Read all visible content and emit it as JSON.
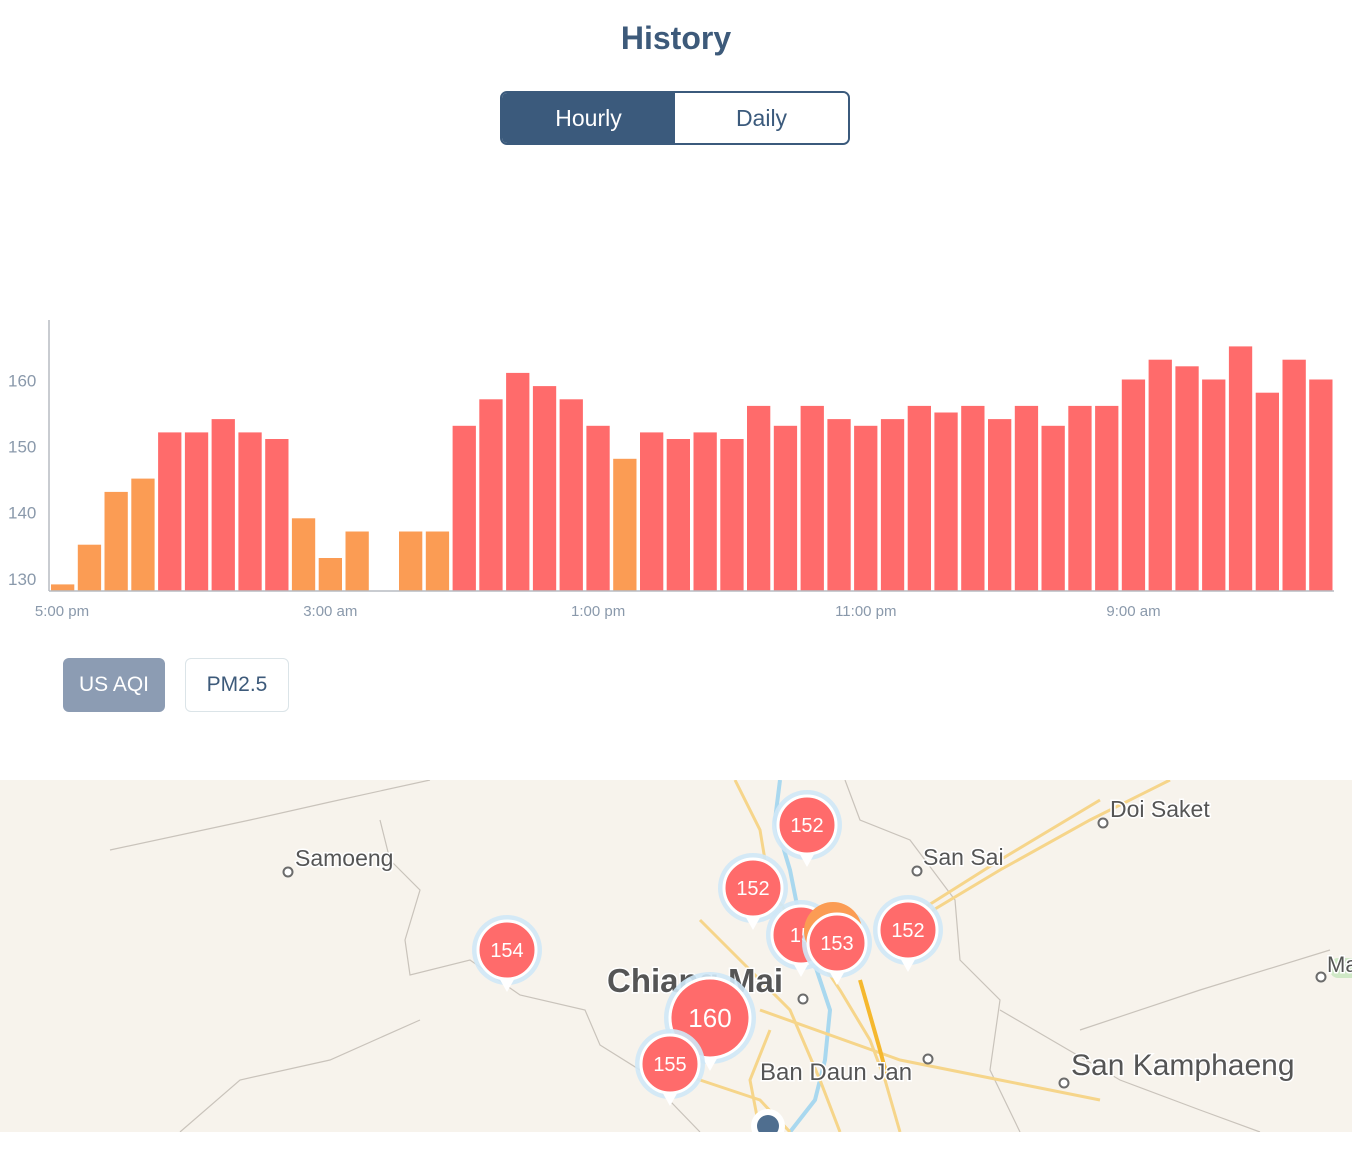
{
  "header": {
    "title": "History"
  },
  "range_toggle": {
    "hourly_label": "Hourly",
    "daily_label": "Daily",
    "selected": "Hourly"
  },
  "metric_toggle": {
    "aqi_label": "US AQI",
    "pm_label": "PM2.5",
    "selected": "US AQI"
  },
  "colors": {
    "unhealthy": "#ff6b6b",
    "sensitive": "#fb9c54",
    "toggle_active": "#3b5a7c",
    "metric_active": "#8c9cb3"
  },
  "chart_data": {
    "type": "bar",
    "title": "",
    "xlabel": "",
    "ylabel": "",
    "ylim": [
      128,
      169
    ],
    "yticks": [
      130,
      140,
      150,
      160
    ],
    "xtick_labels": [
      "5:00 pm",
      "3:00 am",
      "1:00 pm",
      "11:00 pm",
      "9:00 am"
    ],
    "xtick_index": [
      0,
      10,
      20,
      30,
      40
    ],
    "values": [
      129,
      135,
      143,
      145,
      152,
      152,
      154,
      152,
      151,
      139,
      133,
      137,
      null,
      137,
      137,
      153,
      157,
      161,
      159,
      157,
      153,
      148,
      152,
      151,
      152,
      151,
      156,
      153,
      156,
      154,
      153,
      154,
      156,
      155,
      156,
      154,
      156,
      153,
      156,
      156,
      160,
      163,
      162,
      160,
      165,
      158,
      163,
      160
    ],
    "category_threshold": 150,
    "grid": false,
    "legend": "none"
  },
  "map": {
    "places": [
      "Samoeng",
      "San Sai",
      "Doi Saket",
      "Chiang Mai",
      "Ban Daun Jan",
      "San Kamphaeng",
      "Ma"
    ],
    "markers": [
      "152",
      "152",
      "15",
      "153",
      "152",
      "154",
      "160",
      "155"
    ]
  }
}
